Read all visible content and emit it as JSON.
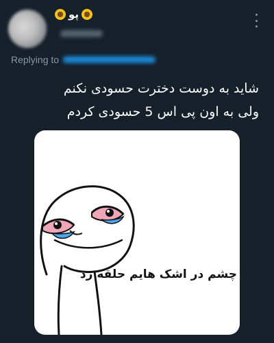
{
  "user": {
    "display_name": "پو"
  },
  "reply": {
    "label": "Replying to"
  },
  "tweet": {
    "line1": "شاید به دوست دخترت حسودی نکنم",
    "line2": "ولی به اون پی اس 5 حسودی کردم"
  },
  "media": {
    "caption": "چشم در اشک هایم حلقه زد"
  },
  "colors": {
    "background": "#15202b",
    "accent": "#1d9bf0",
    "muted": "#8899a6"
  }
}
